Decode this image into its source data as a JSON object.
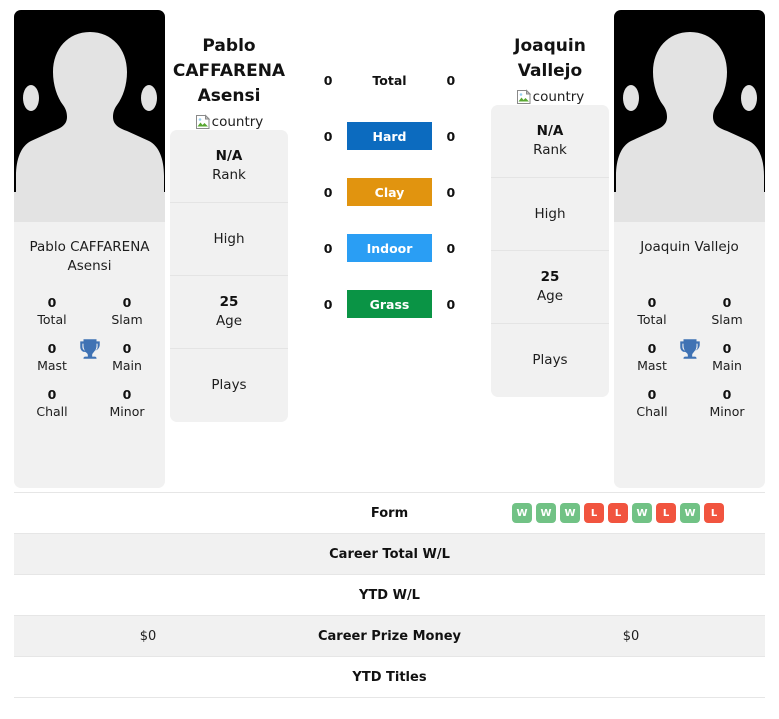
{
  "players": {
    "left": {
      "display_name": "Pablo CAFFARENA Asensi",
      "name_line1": "Pablo",
      "name_line2": "CAFFARENA",
      "name_line3": "Asensi",
      "card_name": "Pablo CAFFARENA Asensi",
      "country_alt": "country",
      "titles": [
        {
          "value": "0",
          "label": "Total"
        },
        {
          "value": "0",
          "label": "Slam"
        },
        {
          "value": "0",
          "label": "Mast"
        },
        {
          "value": "0",
          "label": "Main"
        },
        {
          "value": "0",
          "label": "Chall"
        },
        {
          "value": "0",
          "label": "Minor"
        }
      ],
      "info": [
        {
          "value": "N/A",
          "label": "Rank"
        },
        {
          "value": "",
          "label": "High"
        },
        {
          "value": "25",
          "label": "Age"
        },
        {
          "value": "",
          "label": "Plays"
        }
      ],
      "surface_scores": [
        "0",
        "0",
        "0",
        "0",
        "0"
      ],
      "career_prize_money": "$0",
      "career_total_wl": "",
      "ytd_wl": "",
      "ytd_titles": "",
      "form": []
    },
    "right": {
      "display_name": "Joaquin Vallejo",
      "name_line1": "Joaquin",
      "name_line2": "Vallejo",
      "name_line3": "",
      "card_name": "Joaquin Vallejo",
      "country_alt": "country",
      "titles": [
        {
          "value": "0",
          "label": "Total"
        },
        {
          "value": "0",
          "label": "Slam"
        },
        {
          "value": "0",
          "label": "Mast"
        },
        {
          "value": "0",
          "label": "Main"
        },
        {
          "value": "0",
          "label": "Chall"
        },
        {
          "value": "0",
          "label": "Minor"
        }
      ],
      "info": [
        {
          "value": "N/A",
          "label": "Rank"
        },
        {
          "value": "",
          "label": "High"
        },
        {
          "value": "25",
          "label": "Age"
        },
        {
          "value": "",
          "label": "Plays"
        }
      ],
      "surface_scores": [
        "0",
        "0",
        "0",
        "0",
        "0"
      ],
      "career_prize_money": "$0",
      "career_total_wl": "",
      "ytd_wl": "",
      "ytd_titles": "",
      "form": [
        {
          "result": "W"
        },
        {
          "result": "W"
        },
        {
          "result": "W"
        },
        {
          "result": "L"
        },
        {
          "result": "L"
        },
        {
          "result": "W"
        },
        {
          "result": "L"
        },
        {
          "result": "W"
        },
        {
          "result": "L"
        }
      ]
    }
  },
  "surfaces": [
    {
      "label": "Total",
      "color": "transparent",
      "plain": true
    },
    {
      "label": "Hard",
      "color": "#0c6bbf",
      "plain": false
    },
    {
      "label": "Clay",
      "color": "#e1940f",
      "plain": false
    },
    {
      "label": "Indoor",
      "color": "#2a9ef4",
      "plain": false
    },
    {
      "label": "Grass",
      "color": "#0a9445",
      "plain": false
    }
  ],
  "table_rows": [
    {
      "label": "Form",
      "left": "",
      "right": ""
    },
    {
      "label": "Career Total W/L",
      "left": "",
      "right": ""
    },
    {
      "label": "YTD W/L",
      "left": "",
      "right": ""
    },
    {
      "label": "Career Prize Money",
      "left": "$0",
      "right": "$0"
    },
    {
      "label": "YTD Titles",
      "left": "",
      "right": ""
    }
  ],
  "colors": {
    "win_badge": "#71c285",
    "loss_badge": "#f1543f",
    "card_bg": "#f1f1f1",
    "photo_bg": "#000000",
    "silhouette": "#e3e3e3"
  },
  "icons": {
    "trophy": "trophy-icon",
    "broken_image": "broken-image-icon"
  }
}
